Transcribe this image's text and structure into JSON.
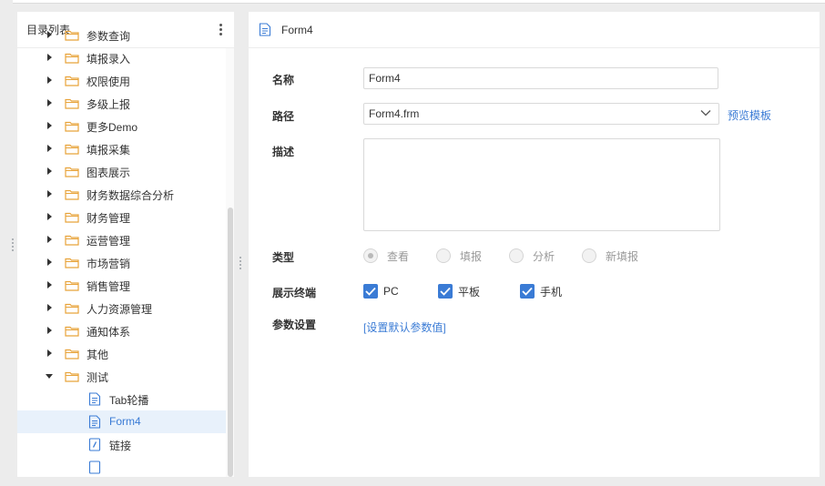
{
  "sidebar": {
    "title": "目录列表",
    "items": [
      {
        "label": "参数查询",
        "icon": "folder-icon",
        "expanded": false
      },
      {
        "label": "填报录入",
        "icon": "folder-icon",
        "expanded": false
      },
      {
        "label": "权限使用",
        "icon": "folder-icon",
        "expanded": false
      },
      {
        "label": "多级上报",
        "icon": "folder-icon",
        "expanded": false
      },
      {
        "label": "更多Demo",
        "icon": "folder-icon",
        "expanded": false
      },
      {
        "label": "填报采集",
        "icon": "folder-icon",
        "expanded": false
      },
      {
        "label": "图表展示",
        "icon": "folder-icon",
        "expanded": false
      },
      {
        "label": "财务数据综合分析",
        "icon": "folder-icon",
        "expanded": false
      },
      {
        "label": "财务管理",
        "icon": "folder-icon",
        "expanded": false
      },
      {
        "label": "运营管理",
        "icon": "folder-icon",
        "expanded": false
      },
      {
        "label": "市场营销",
        "icon": "folder-icon",
        "expanded": false
      },
      {
        "label": "销售管理",
        "icon": "folder-icon",
        "expanded": false
      },
      {
        "label": "人力资源管理",
        "icon": "folder-icon",
        "expanded": false
      },
      {
        "label": "通知体系",
        "icon": "folder-icon",
        "expanded": false
      },
      {
        "label": "其他",
        "icon": "folder-icon",
        "expanded": false
      },
      {
        "label": "测试",
        "icon": "folder-icon",
        "expanded": true
      }
    ],
    "children": [
      {
        "label": "Tab轮播",
        "icon": "file-icon",
        "selected": false
      },
      {
        "label": "Form4",
        "icon": "file-icon",
        "selected": true
      },
      {
        "label": "链接",
        "icon": "link-file-icon",
        "selected": false
      }
    ]
  },
  "content": {
    "title": "Form4",
    "name_label": "名称",
    "name_value": "Form4",
    "path_label": "路径",
    "path_value": "Form4.frm",
    "preview_link": "预览模板",
    "desc_label": "描述",
    "type_label": "类型",
    "type_options": [
      {
        "label": "查看",
        "checked": true
      },
      {
        "label": "填报",
        "checked": false
      },
      {
        "label": "分析",
        "checked": false
      },
      {
        "label": "新填报",
        "checked": false
      }
    ],
    "terminal_label": "展示终端",
    "terminals": [
      {
        "label": "PC",
        "checked": true
      },
      {
        "label": "平板",
        "checked": true
      },
      {
        "label": "手机",
        "checked": true
      }
    ],
    "param_label": "参数设置",
    "param_link": "[设置默认参数值]"
  },
  "colors": {
    "accent": "#3a7bd5",
    "folder": "#e8a33a",
    "selected_bg": "#e8f1fb"
  }
}
